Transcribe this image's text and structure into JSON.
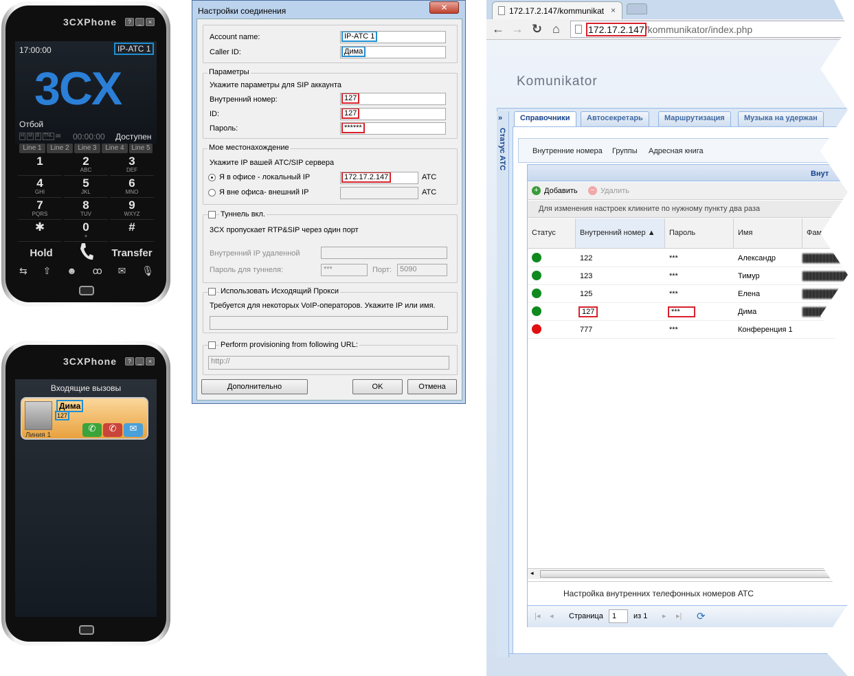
{
  "phone1": {
    "brand": "3CXPhone",
    "win_buttons": [
      "?",
      "_",
      "×"
    ],
    "time": "17:00:00",
    "account": "IP-ATC 1",
    "logo": "3CX",
    "status_left": "Отбой",
    "timer": "00:00:00",
    "status_right": "Доступен",
    "indicators": [
      "H",
      "M",
      "B",
      "TNL"
    ],
    "lines": [
      "Line 1",
      "Line 2",
      "Line 3",
      "Line 4",
      "Line 5"
    ],
    "keys": [
      {
        "d": "1",
        "s": ""
      },
      {
        "d": "2",
        "s": "ABC"
      },
      {
        "d": "3",
        "s": "DEF"
      },
      {
        "d": "4",
        "s": "GHI"
      },
      {
        "d": "5",
        "s": "JKL"
      },
      {
        "d": "6",
        "s": "MNO"
      },
      {
        "d": "7",
        "s": "PQRS"
      },
      {
        "d": "8",
        "s": "TUV"
      },
      {
        "d": "9",
        "s": "WXYZ"
      },
      {
        "d": "✱",
        "s": ""
      },
      {
        "d": "0",
        "s": "+"
      },
      {
        "d": "#",
        "s": ""
      }
    ],
    "hold": "Hold",
    "transfer": "Transfer"
  },
  "phone2": {
    "brand": "3CXPhone",
    "incoming_title": "Входящие вызовы",
    "caller_name": "Дима",
    "caller_number": "127",
    "line": "Линия 1"
  },
  "dialog": {
    "title": "Настройки соединения",
    "close": "✕",
    "account_name_label": "Account name:",
    "account_name": "IP-ATC 1",
    "caller_id_label": "Caller ID:",
    "caller_id": "Дима",
    "params_caption": "Параметры",
    "params_hint": "Укажите параметры для SIP аккаунта",
    "ext_label": "Внутренний номер:",
    "ext": "127",
    "id_label": "ID:",
    "id": "127",
    "password_label": "Пароль:",
    "password": "******",
    "location_caption": "Мое местонахождение",
    "location_hint": "Укажите IP вашей АТС/SIP сервера",
    "local_label": "Я в офисе - локальный IP",
    "local_ip": "172.17.2.147",
    "local_suffix": "АТС",
    "external_label": "Я вне офиса- внешний IP",
    "external_ip": "",
    "external_suffix": "АТС",
    "tunnel_caption": "Туннель вкл.",
    "tunnel_hint": "3CX пропускает RTP&SIP через один порт",
    "tunnel_remote_label": "Внутренний IP удаленной",
    "tunnel_pass_label": "Пароль для туннеля:",
    "tunnel_pass": "***",
    "port_label": "Порт:",
    "port": "5090",
    "proxy_caption": "Использовать Исходящий Прокси",
    "proxy_hint": "Требуется для некоторых VoIP-операторов. Укажите IP или имя.",
    "prov_caption": "Perform provisioning from following URL:",
    "prov_url": "http://",
    "btn_advanced": "Дополнительно",
    "btn_ok": "OK",
    "btn_cancel": "Отмена"
  },
  "browser": {
    "tab_title": "172.17.2.147/kommunikat",
    "url_host": "172.17.2.147",
    "url_path": "/kommunikator/index.php",
    "logo": "Komunikator",
    "side_title": "Статус АТС",
    "main_tabs": [
      "Справочники",
      "Автосекретарь",
      "Маршрутизация",
      "Музыка на удержан"
    ],
    "sub_tabs": [
      "Внутренние номера",
      "Группы",
      "Адресная книга"
    ],
    "grid_title": "Внут",
    "add": "Добавить",
    "remove": "Удалить",
    "hint": "Для изменения настроек кликните по нужному пункту два раза",
    "columns": [
      "Статус",
      "Внутренний номер ▲",
      "Пароль",
      "Имя",
      "Фамилия"
    ],
    "rows": [
      {
        "status": "green",
        "number": "122",
        "password": "***",
        "name": "Александр"
      },
      {
        "status": "green",
        "number": "123",
        "password": "***",
        "name": "Тимур"
      },
      {
        "status": "green",
        "number": "125",
        "password": "***",
        "name": "Елена"
      },
      {
        "status": "green",
        "number": "127",
        "password": "***",
        "name": "Дима"
      },
      {
        "status": "red",
        "number": "777",
        "password": "***",
        "name": "Конференция 1"
      }
    ],
    "footer": "Настройка внутренних телефонных номеров АТС",
    "page_label": "Страница",
    "page": "1",
    "page_of": "из 1"
  },
  "colors": {
    "highlight_blue": "#1e8fd3",
    "highlight_red": "#d8202a",
    "online": "#0f8a1e",
    "offline": "#e01010"
  }
}
